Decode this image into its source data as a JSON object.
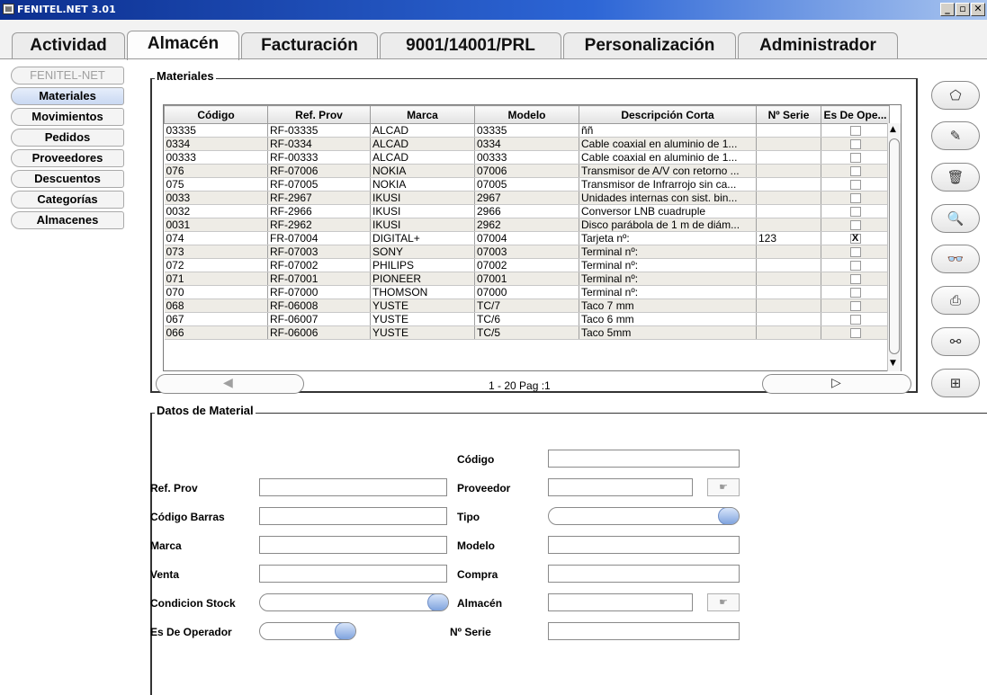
{
  "window": {
    "title": "FENITEL.NET 3.01",
    "icon": "app-icon",
    "min": "_",
    "max": "▫",
    "close": "✕"
  },
  "tabs": [
    "Actividad",
    "Almacén",
    "Facturación",
    "9001/14001/PRL",
    "Personalización",
    "Administrador"
  ],
  "active_tab": "Almacén",
  "leftnav": [
    "FENITEL-NET",
    "Materiales",
    "Movimientos",
    "Pedidos",
    "Proveedores",
    "Descuentos",
    "Categorías",
    "Almacenes"
  ],
  "materiales": {
    "legend": "Materiales",
    "columns": [
      "Código",
      "Ref. Prov",
      "Marca",
      "Modelo",
      "Descripción Corta",
      "Nº Serie",
      "Es De Ope..."
    ],
    "rows": [
      [
        "03335",
        "RF-03335",
        "ALCAD",
        "03335",
        "ññ",
        "",
        ""
      ],
      [
        "0334",
        "RF-0334",
        "ALCAD",
        "0334",
        "Cable coaxial en aluminio de 1...",
        "",
        ""
      ],
      [
        "00333",
        "RF-00333",
        "ALCAD",
        "00333",
        "Cable coaxial en aluminio de 1...",
        "",
        ""
      ],
      [
        "076",
        "RF-07006",
        "NOKIA",
        "07006",
        "Transmisor de A/V con retorno ...",
        "",
        ""
      ],
      [
        "075",
        "RF-07005",
        "NOKIA",
        "07005",
        "Transmisor de Infrarrojo sin ca...",
        "",
        ""
      ],
      [
        "0033",
        "RF-2967",
        "IKUSI",
        "2967",
        "Unidades internas con sist. bin...",
        "",
        ""
      ],
      [
        "0032",
        "RF-2966",
        "IKUSI",
        "2966",
        "Conversor LNB cuadruple",
        "",
        ""
      ],
      [
        "0031",
        "RF-2962",
        "IKUSI",
        "2962",
        "Disco parábola de 1 m de diám...",
        "",
        ""
      ],
      [
        "074",
        "FR-07004",
        "DIGITAL+",
        "07004",
        "Tarjeta nº:",
        "123",
        "X"
      ],
      [
        "073",
        "RF-07003",
        "SONY",
        "07003",
        "Terminal nº:",
        "",
        ""
      ],
      [
        "072",
        "RF-07002",
        "PHILIPS",
        "07002",
        "Terminal nº:",
        "",
        ""
      ],
      [
        "071",
        "RF-07001",
        "PIONEER",
        "07001",
        "Terminal nº:",
        "",
        ""
      ],
      [
        "070",
        "RF-07000",
        "THOMSON",
        "07000",
        "Terminal nº:",
        "",
        ""
      ],
      [
        "068",
        "RF-06008",
        "YUSTE",
        "TC/7",
        "Taco 7 mm",
        "",
        ""
      ],
      [
        "067",
        "RF-06007",
        "YUSTE",
        "TC/6",
        "Taco 6 mm",
        "",
        ""
      ],
      [
        "066",
        "RF-06006",
        "YUSTE",
        "TC/5",
        "Taco 5mm",
        "",
        ""
      ]
    ],
    "pager": "1 - 20 Pag :1",
    "prev_icon": "triangle-left-icon",
    "next_icon": "triangle-right-icon"
  },
  "toolbar": [
    {
      "name": "new-icon",
      "glyph": "⬠"
    },
    {
      "name": "edit-icon",
      "glyph": "✎"
    },
    {
      "name": "delete-icon",
      "glyph": "🗑"
    },
    {
      "name": "search-icon",
      "glyph": "🔍"
    },
    {
      "name": "binoculars-icon",
      "glyph": "👓"
    },
    {
      "name": "print-icon",
      "glyph": "⎙"
    },
    {
      "name": "link-icon",
      "glyph": "⚯"
    },
    {
      "name": "grid-icon",
      "glyph": "⊞"
    }
  ],
  "datos": {
    "legend": "Datos de Material",
    "labels": {
      "codigo": "Código",
      "ref_prov": "Ref. Prov",
      "proveedor": "Proveedor",
      "codigo_barras": "Código Barras",
      "tipo": "Tipo",
      "marca": "Marca",
      "modelo": "Modelo",
      "venta": "Venta",
      "compra": "Compra",
      "condicion_stock": "Condicion Stock",
      "almacen": "Almacén",
      "es_de_operador": "Es De Operador",
      "n_serie": "Nº Serie"
    }
  }
}
